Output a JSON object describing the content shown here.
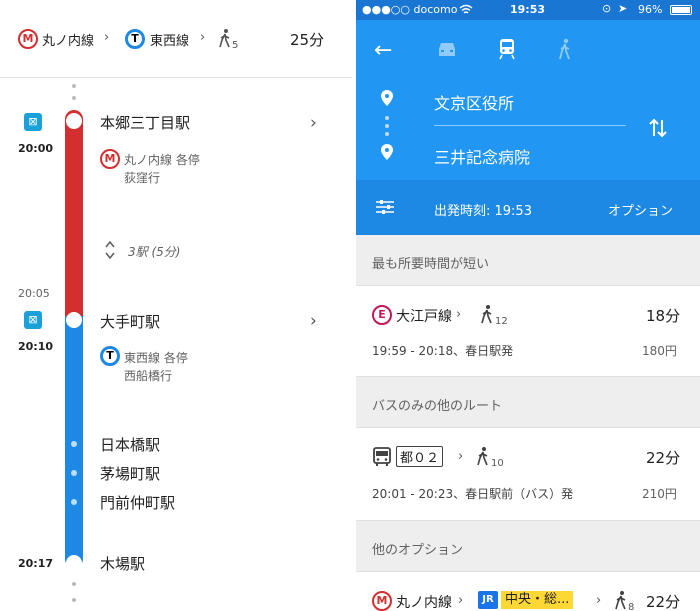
{
  "left": {
    "summary": {
      "line1_badge": "M",
      "line1": "丸ノ内線",
      "line2_badge": "T",
      "line2": "東西線",
      "walk_min": "5",
      "total": "25分"
    },
    "timeline": {
      "start_station": "本郷三丁目駅",
      "start_time": "20:00",
      "segment1_badge": "M",
      "segment1_line": "丸ノ内線 各停",
      "segment1_dest": "荻窪行",
      "segment1_stops": "3駅 (5分)",
      "arrive_time": "20:05",
      "transfer_station": "大手町駅",
      "depart_time": "20:10",
      "segment2_badge": "T",
      "segment2_line": "東西線 各停",
      "segment2_dest": "西船橋行",
      "intermediate": [
        "日本橋駅",
        "茅場町駅",
        "門前仲町駅"
      ],
      "end_station": "木場駅",
      "end_time": "20:17"
    }
  },
  "right": {
    "status": {
      "carrier": "●●●○○ docomo",
      "time": "19:53",
      "battery": "96%"
    },
    "origin": "文京区役所",
    "destination": "三井記念病院",
    "depart_label": "出発時刻: 19:53",
    "options_label": "オプション",
    "sections": [
      {
        "title": "最も所要時間が短い",
        "route": {
          "badge": "E",
          "line": "大江戸線",
          "walk": "12",
          "duration": "18分",
          "times": "19:59 - 20:18、春日駅発",
          "fare": "180円"
        }
      },
      {
        "title": "バスのみの他のルート",
        "route": {
          "line": "都０２",
          "walk": "10",
          "duration": "22分",
          "times": "20:01 - 20:23、春日駅前（バス）発",
          "fare": "210円"
        }
      },
      {
        "title": "他のオプション",
        "route": {
          "badge": "M",
          "line": "丸ノ内線",
          "jr_badge": "JR",
          "jr_line": "中央・総...",
          "walk": "8",
          "duration": "22分"
        }
      }
    ],
    "colors": {
      "header_blue": "#2196f3",
      "marunouchi_red": "#d32f2f",
      "tozai_blue": "#1e88e5",
      "oedo_magenta": "#c2185b",
      "chuo_yellow": "#fdd835"
    }
  }
}
